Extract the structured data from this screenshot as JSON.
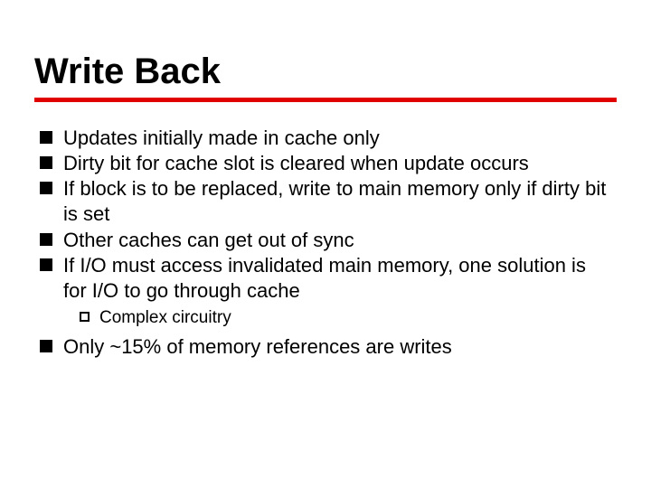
{
  "title": "Write Back",
  "bullets": [
    "Updates initially made in cache only",
    "Dirty bit for cache slot is cleared when update occurs",
    "If block is to be replaced, write to main memory only if dirty bit is set",
    "Other caches can get out of sync",
    "If I/O must access invalidated main memory, one solution is for I/O to go through cache",
    "Only ~15% of memory references are writes"
  ],
  "subbullet_after_index": 4,
  "subbullets": [
    "Complex circuitry"
  ],
  "colors": {
    "rule": "#e00000"
  }
}
